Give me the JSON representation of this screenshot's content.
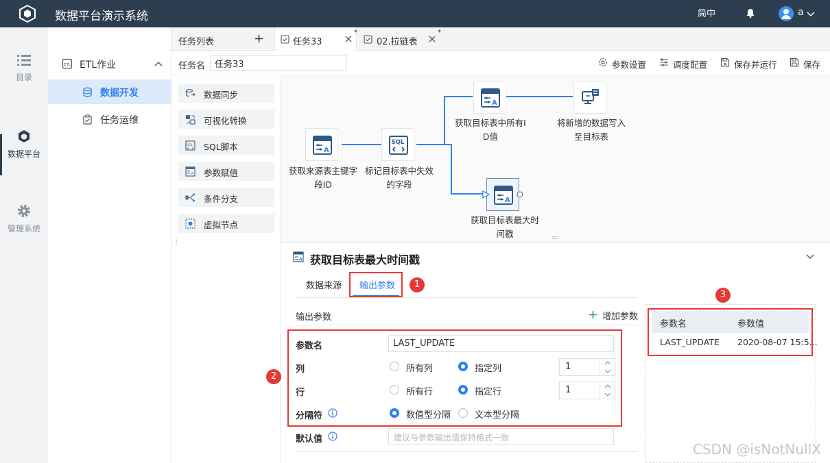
{
  "header": {
    "app_title": "数据平台演示系统",
    "language": "简中",
    "user": "a"
  },
  "rail": {
    "items": [
      {
        "label": "目录"
      },
      {
        "label": "数据平台"
      },
      {
        "label": "管理系统"
      }
    ]
  },
  "nav": {
    "group": "ETL作业",
    "items": [
      {
        "label": "数据开发"
      },
      {
        "label": "任务运维"
      }
    ]
  },
  "tabs": {
    "list_label": "任务列表",
    "items": [
      {
        "label": "任务33"
      },
      {
        "label": "02.拉链表"
      }
    ]
  },
  "task": {
    "name_label": "任务名",
    "name_value": "任务33"
  },
  "toolbar": {
    "param_settings": "参数设置",
    "schedule": "调度配置",
    "save_run": "保存并运行",
    "save": "保存"
  },
  "palette": {
    "items": [
      {
        "label": "数据同步",
        "icon": "data-sync-icon"
      },
      {
        "label": "可视化转换",
        "icon": "visual-transform-icon"
      },
      {
        "label": "SQL脚本",
        "icon": "sql-script-icon"
      },
      {
        "label": "参数赋值",
        "icon": "param-assign-icon"
      },
      {
        "label": "条件分支",
        "icon": "condition-branch-icon"
      },
      {
        "label": "虚拟节点",
        "icon": "virtual-node-icon"
      }
    ]
  },
  "flow": {
    "nodes": [
      {
        "label1": "获取来源表主键字",
        "label2": "段ID"
      },
      {
        "label1": "标记目标表中失效",
        "label2": "的字段"
      },
      {
        "label1": "获取目标表中所有I",
        "label2": "D值"
      },
      {
        "label1": "将新增的数据写入",
        "label2": "至目标表"
      },
      {
        "label1": "获取目标表最大时",
        "label2": "间戳"
      }
    ]
  },
  "panel": {
    "title": "获取目标表最大时间戳",
    "tabs": [
      "数据来源",
      "输出参数"
    ],
    "section_title": "输出参数",
    "add_param": "增加参数",
    "fields": {
      "param_name_label": "参数名",
      "param_name_value": "LAST_UPDATE",
      "col_label": "列",
      "col_opt_all": "所有列",
      "col_opt_specific": "指定列",
      "col_value": "1",
      "row_label": "行",
      "row_opt_all": "所有行",
      "row_opt_specific": "指定行",
      "row_value": "1",
      "sep_label": "分隔符",
      "sep_opt_numeric": "数值型分隔",
      "sep_opt_text": "文本型分隔",
      "default_label": "默认值",
      "default_placeholder": "建议与参数输出值保持格式一致"
    },
    "preview": {
      "headers": [
        "参数名",
        "参数值"
      ],
      "rows": [
        [
          "LAST_UPDATE",
          "2020-08-07 15:5..."
        ]
      ]
    }
  },
  "badges": [
    "1",
    "2",
    "3"
  ],
  "watermark": "CSDN @isNotNullX",
  "colors": {
    "header_bg": "#2d3e50",
    "accent": "#2f80ed",
    "annotation": "#e53935"
  }
}
